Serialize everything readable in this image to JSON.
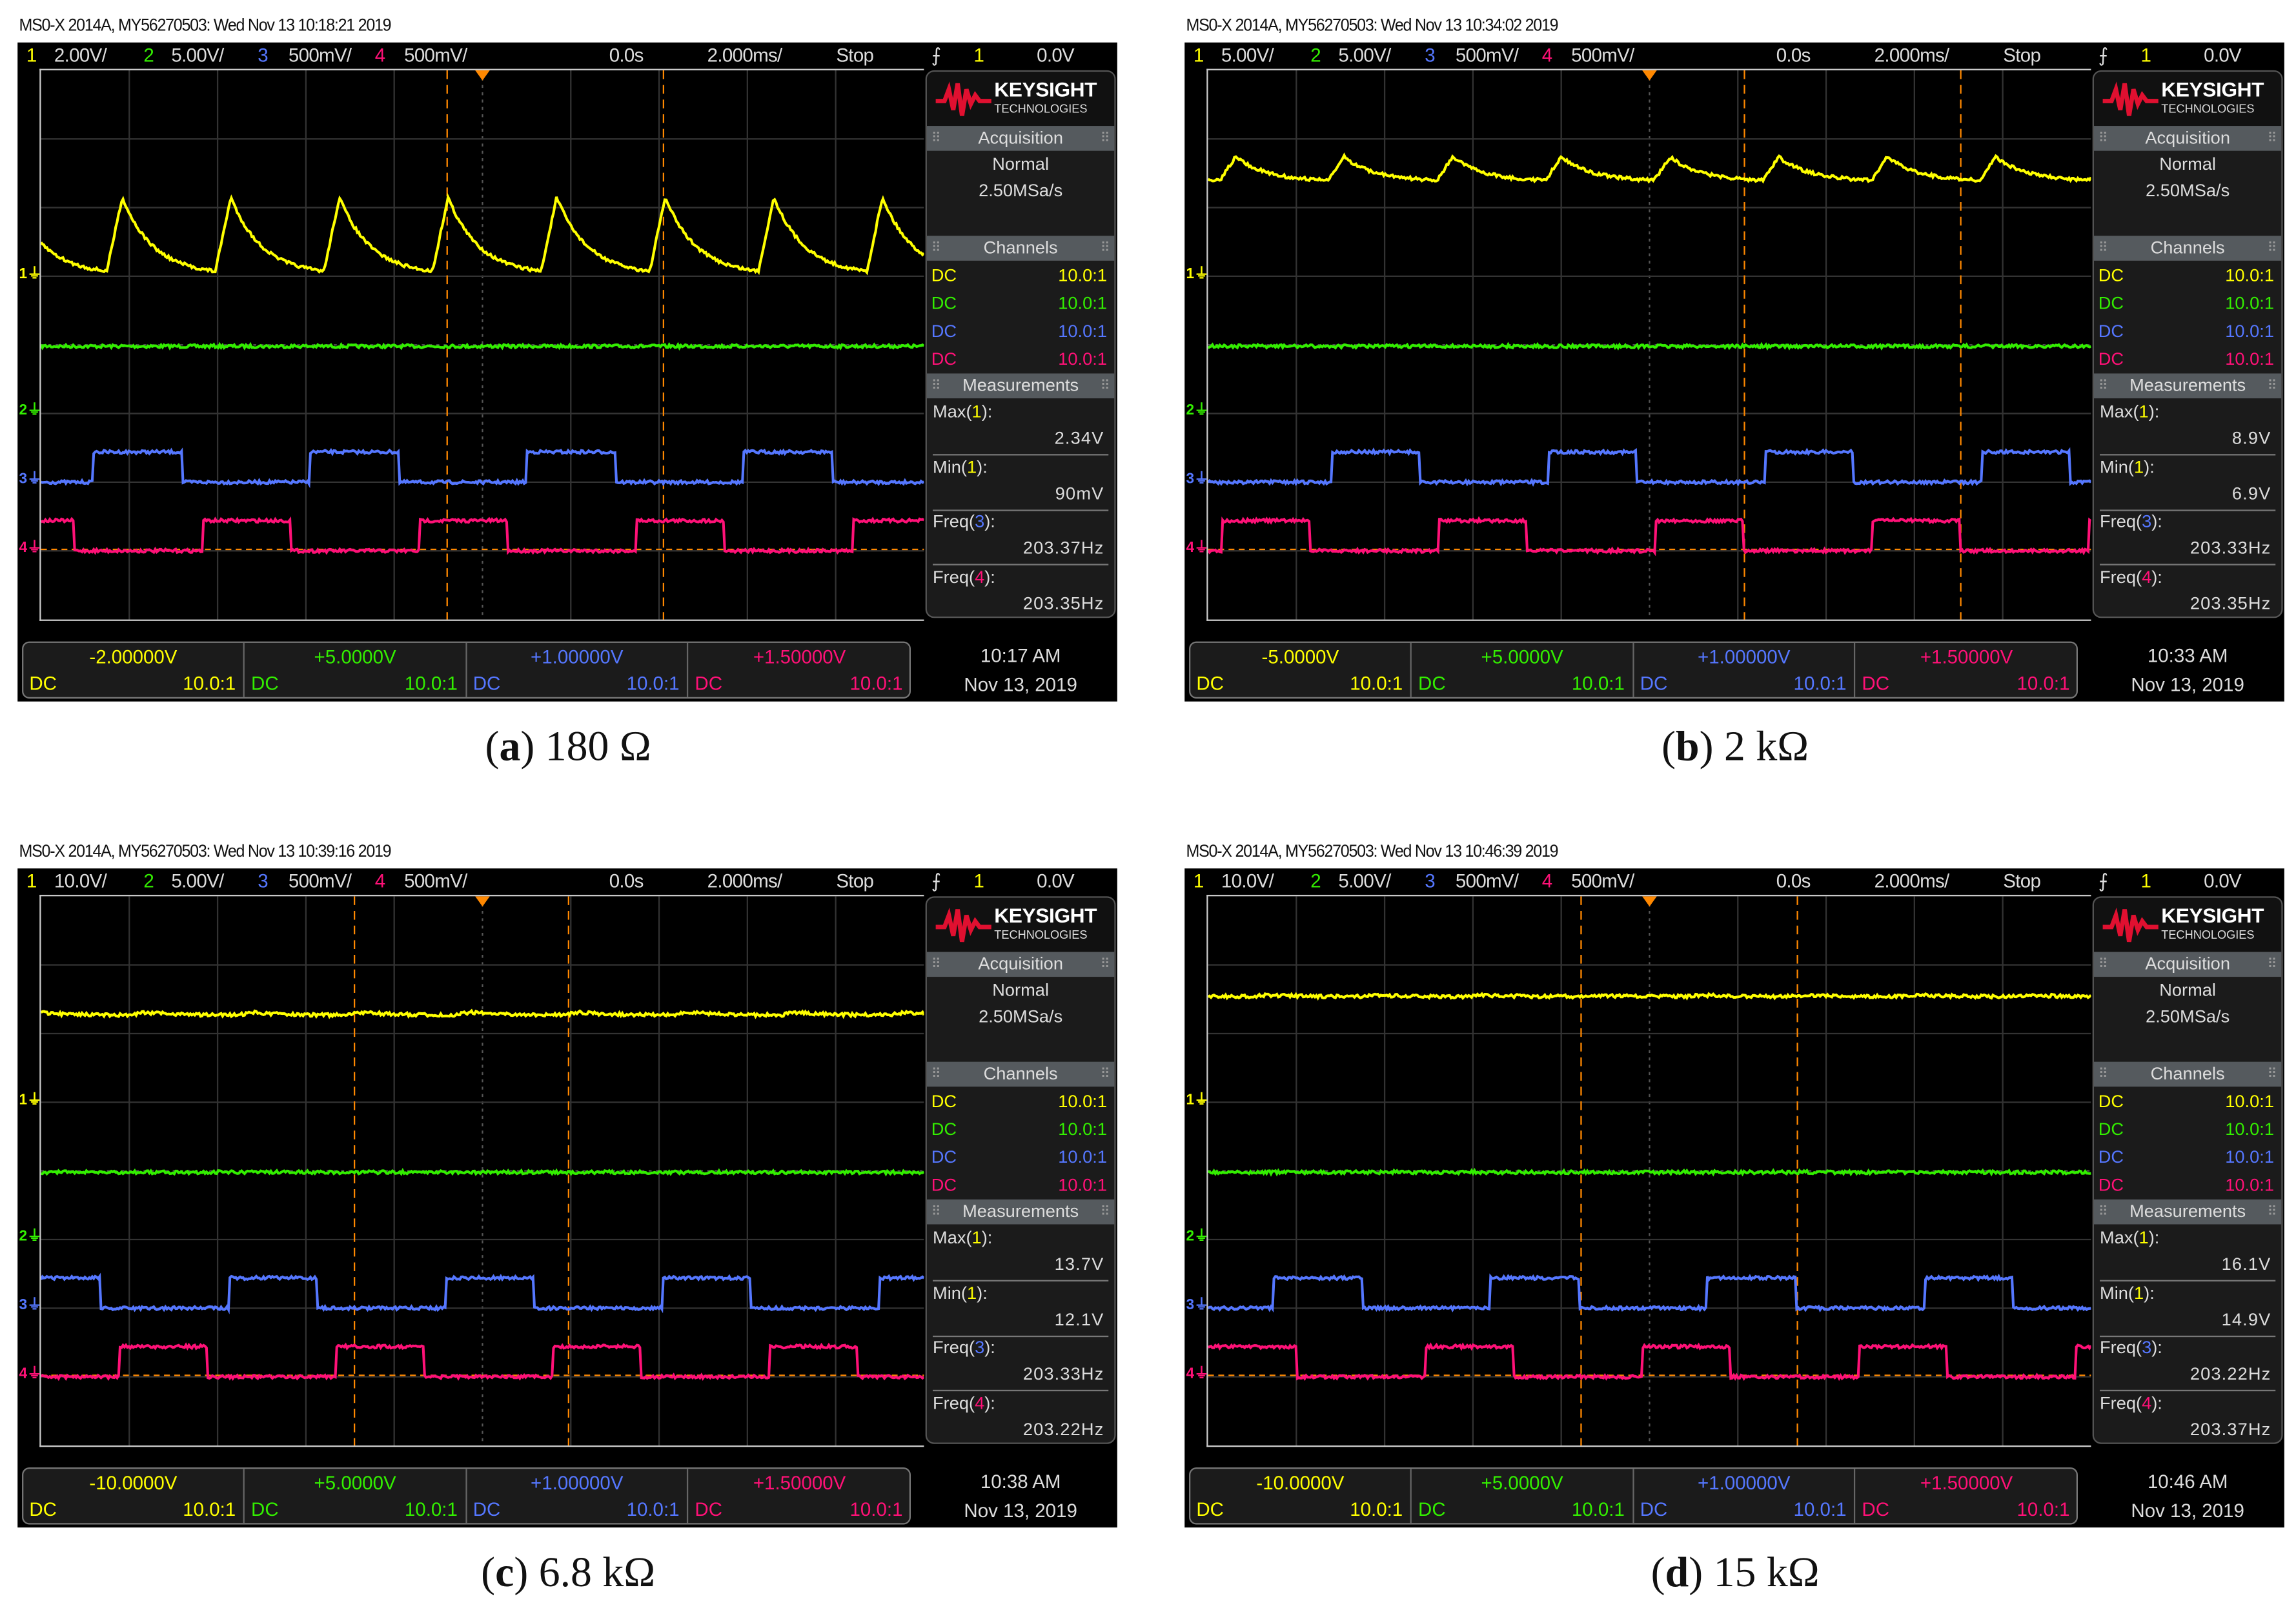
{
  "colors": {
    "ch1": "#ffff00",
    "ch2": "#33ee00",
    "ch3": "#5577ff",
    "ch4": "#ff1177",
    "cursor": "#ff8800",
    "grid": "#333333"
  },
  "panels": [
    {
      "caption": {
        "letter": "a",
        "value": "180 Ω"
      },
      "header": "MS0-X 2014A, MY56270503: Wed Nov 13 10:18:21 2019",
      "topbar": {
        "channels": [
          {
            "num": "1",
            "scale": "2.00V/"
          },
          {
            "num": "2",
            "scale": "5.00V/"
          },
          {
            "num": "3",
            "scale": "500mV/"
          },
          {
            "num": "4",
            "scale": "500mV/"
          }
        ],
        "time_pos": "0.0s",
        "timebase": "2.000ms/",
        "run_state": "Stop",
        "trig_src": "1",
        "trig_level": "0.0V"
      },
      "logo": {
        "brand": "KEYSIGHT",
        "sub": "TECHNOLOGIES"
      },
      "acquisition": {
        "title": "Acquisition",
        "mode": "Normal",
        "rate": "2.50MSa/s"
      },
      "channels": {
        "title": "Channels",
        "rows": [
          {
            "coupling": "DC",
            "probe": "10.0:1"
          },
          {
            "coupling": "DC",
            "probe": "10.0:1"
          },
          {
            "coupling": "DC",
            "probe": "10.0:1"
          },
          {
            "coupling": "DC",
            "probe": "10.0:1"
          }
        ]
      },
      "measurements": {
        "title": "Measurements",
        "items": [
          {
            "name": "Max(",
            "src": "1",
            "end": "):",
            "value": "2.34V"
          },
          {
            "name": "Min(",
            "src": "1",
            "end": "):",
            "value": "90mV"
          },
          {
            "name": "Freq(",
            "src": "3",
            "end": "):",
            "value": "203.37Hz"
          },
          {
            "name": "Freq(",
            "src": "4",
            "end": "):",
            "value": "203.35Hz"
          }
        ]
      },
      "bottom": {
        "offsets": [
          "-2.00000V",
          "+5.0000V",
          "+1.00000V",
          "+1.50000V"
        ],
        "coupling": "DC",
        "probe": "10.0:1",
        "time": "10:17 AM",
        "date": "Nov 13, 2019"
      },
      "wave": {
        "vdiv": [
          2,
          5,
          0.5,
          0.5
        ],
        "offset": [
          -2,
          5,
          1,
          1.5
        ],
        "ch1": {
          "low": 0.15,
          "high": 2.3,
          "first_rise_ms": -8.51,
          "period_ms": 2.46
        },
        "ch2_level": 4.9,
        "sq_high": 0.22,
        "sq_period_ms": 4.91,
        "sq_width_ms": 2.0,
        "ch3_rise_ms": -8.81,
        "ch4_rise_ms": -6.35,
        "cursors_ms": [
          -0.8,
          4.1
        ]
      }
    },
    {
      "caption": {
        "letter": "b",
        "value": "2 kΩ"
      },
      "header": "MS0-X 2014A, MY56270503: Wed Nov 13 10:34:02 2019",
      "topbar": {
        "channels": [
          {
            "num": "1",
            "scale": "5.00V/"
          },
          {
            "num": "2",
            "scale": "5.00V/"
          },
          {
            "num": "3",
            "scale": "500mV/"
          },
          {
            "num": "4",
            "scale": "500mV/"
          }
        ],
        "time_pos": "0.0s",
        "timebase": "2.000ms/",
        "run_state": "Stop",
        "trig_src": "1",
        "trig_level": "0.0V"
      },
      "logo": {
        "brand": "KEYSIGHT",
        "sub": "TECHNOLOGIES"
      },
      "acquisition": {
        "title": "Acquisition",
        "mode": "Normal",
        "rate": "2.50MSa/s"
      },
      "channels": {
        "title": "Channels",
        "rows": [
          {
            "coupling": "DC",
            "probe": "10.0:1"
          },
          {
            "coupling": "DC",
            "probe": "10.0:1"
          },
          {
            "coupling": "DC",
            "probe": "10.0:1"
          },
          {
            "coupling": "DC",
            "probe": "10.0:1"
          }
        ]
      },
      "measurements": {
        "title": "Measurements",
        "items": [
          {
            "name": "Max(",
            "src": "1",
            "end": "):",
            "value": "8.9V"
          },
          {
            "name": "Min(",
            "src": "1",
            "end": "):",
            "value": "6.9V"
          },
          {
            "name": "Freq(",
            "src": "3",
            "end": "):",
            "value": "203.33Hz"
          },
          {
            "name": "Freq(",
            "src": "4",
            "end": "):",
            "value": "203.35Hz"
          }
        ]
      },
      "bottom": {
        "offsets": [
          "-5.0000V",
          "+5.0000V",
          "+1.00000V",
          "+1.50000V"
        ],
        "coupling": "DC",
        "probe": "10.0:1",
        "time": "10:33 AM",
        "date": "Nov 13, 2019"
      },
      "wave": {
        "vdiv": [
          5,
          5,
          0.5,
          0.5
        ],
        "offset": [
          -5,
          5,
          1,
          1.5
        ],
        "ch1": {
          "low": 7.0,
          "high": 8.7,
          "first_rise_ms": -9.73,
          "period_ms": 2.46
        },
        "ch2_level": 4.9,
        "sq_high": 0.22,
        "sq_period_ms": 4.91,
        "sq_width_ms": 2.0,
        "ch3_rise_ms": -7.21,
        "ch4_rise_ms": -9.7,
        "cursors_ms": [
          2.15,
          7.05
        ]
      }
    },
    {
      "caption": {
        "letter": "c",
        "value": "6.8 kΩ"
      },
      "header": "MS0-X 2014A, MY56270503: Wed Nov 13 10:39:16 2019",
      "topbar": {
        "channels": [
          {
            "num": "1",
            "scale": "10.0V/"
          },
          {
            "num": "2",
            "scale": "5.00V/"
          },
          {
            "num": "3",
            "scale": "500mV/"
          },
          {
            "num": "4",
            "scale": "500mV/"
          }
        ],
        "time_pos": "0.0s",
        "timebase": "2.000ms/",
        "run_state": "Stop",
        "trig_src": "1",
        "trig_level": "0.0V"
      },
      "logo": {
        "brand": "KEYSIGHT",
        "sub": "TECHNOLOGIES"
      },
      "acquisition": {
        "title": "Acquisition",
        "mode": "Normal",
        "rate": "2.50MSa/s"
      },
      "channels": {
        "title": "Channels",
        "rows": [
          {
            "coupling": "DC",
            "probe": "10.0:1"
          },
          {
            "coupling": "DC",
            "probe": "10.0:1"
          },
          {
            "coupling": "DC",
            "probe": "10.0:1"
          },
          {
            "coupling": "DC",
            "probe": "10.0:1"
          }
        ]
      },
      "measurements": {
        "title": "Measurements",
        "items": [
          {
            "name": "Max(",
            "src": "1",
            "end": "):",
            "value": "13.7V"
          },
          {
            "name": "Min(",
            "src": "1",
            "end": "):",
            "value": "12.1V"
          },
          {
            "name": "Freq(",
            "src": "3",
            "end": "):",
            "value": "203.33Hz"
          },
          {
            "name": "Freq(",
            "src": "4",
            "end": "):",
            "value": "203.22Hz"
          }
        ]
      },
      "bottom": {
        "offsets": [
          "-10.0000V",
          "+5.0000V",
          "+1.00000V",
          "+1.50000V"
        ],
        "coupling": "DC",
        "probe": "10.0:1",
        "time": "10:38 AM",
        "date": "Nov 13, 2019"
      },
      "wave": {
        "vdiv": [
          10,
          5,
          0.5,
          0.5
        ],
        "offset": [
          -10,
          5,
          1,
          1.5
        ],
        "ch1": {
          "low": 12.7,
          "high": 13.1,
          "first_rise_ms": -8.0,
          "period_ms": 2.46
        },
        "ch2_level": 4.9,
        "sq_high": 0.22,
        "sq_period_ms": 4.91,
        "sq_width_ms": 2.0,
        "ch3_rise_ms": -5.75,
        "ch4_rise_ms": -8.24,
        "cursors_ms": [
          -2.9,
          1.95
        ]
      }
    },
    {
      "caption": {
        "letter": "d",
        "value": "15 kΩ"
      },
      "header": "MS0-X 2014A, MY56270503: Wed Nov 13 10:46:39 2019",
      "topbar": {
        "channels": [
          {
            "num": "1",
            "scale": "10.0V/"
          },
          {
            "num": "2",
            "scale": "5.00V/"
          },
          {
            "num": "3",
            "scale": "500mV/"
          },
          {
            "num": "4",
            "scale": "500mV/"
          }
        ],
        "time_pos": "0.0s",
        "timebase": "2.000ms/",
        "run_state": "Stop",
        "trig_src": "1",
        "trig_level": "0.0V"
      },
      "logo": {
        "brand": "KEYSIGHT",
        "sub": "TECHNOLOGIES"
      },
      "acquisition": {
        "title": "Acquisition",
        "mode": "Normal",
        "rate": "2.50MSa/s"
      },
      "channels": {
        "title": "Channels",
        "rows": [
          {
            "coupling": "DC",
            "probe": "10.0:1"
          },
          {
            "coupling": "DC",
            "probe": "10.0:1"
          },
          {
            "coupling": "DC",
            "probe": "10.0:1"
          },
          {
            "coupling": "DC",
            "probe": "10.0:1"
          }
        ]
      },
      "measurements": {
        "title": "Measurements",
        "items": [
          {
            "name": "Max(",
            "src": "1",
            "end": "):",
            "value": "16.1V"
          },
          {
            "name": "Min(",
            "src": "1",
            "end": "):",
            "value": "14.9V"
          },
          {
            "name": "Freq(",
            "src": "3",
            "end": "):",
            "value": "203.22Hz"
          },
          {
            "name": "Freq(",
            "src": "4",
            "end": "):",
            "value": "203.37Hz"
          }
        ]
      },
      "bottom": {
        "offsets": [
          "-10.0000V",
          "+5.0000V",
          "+1.00000V",
          "+1.50000V"
        ],
        "coupling": "DC",
        "probe": "10.0:1",
        "time": "10:46 AM",
        "date": "Nov 13, 2019"
      },
      "wave": {
        "vdiv": [
          10,
          5,
          0.5,
          0.5
        ],
        "offset": [
          -10,
          5,
          1,
          1.5
        ],
        "ch1": {
          "low": 15.4,
          "high": 15.6,
          "first_rise_ms": -9.0,
          "period_ms": 2.46
        },
        "ch2_level": 4.9,
        "sq_high": 0.22,
        "sq_period_ms": 4.91,
        "sq_width_ms": 2.0,
        "ch3_rise_ms": -8.51,
        "ch4_rise_ms": -10.0,
        "cursors_ms": [
          -1.55,
          3.35
        ]
      }
    }
  ]
}
